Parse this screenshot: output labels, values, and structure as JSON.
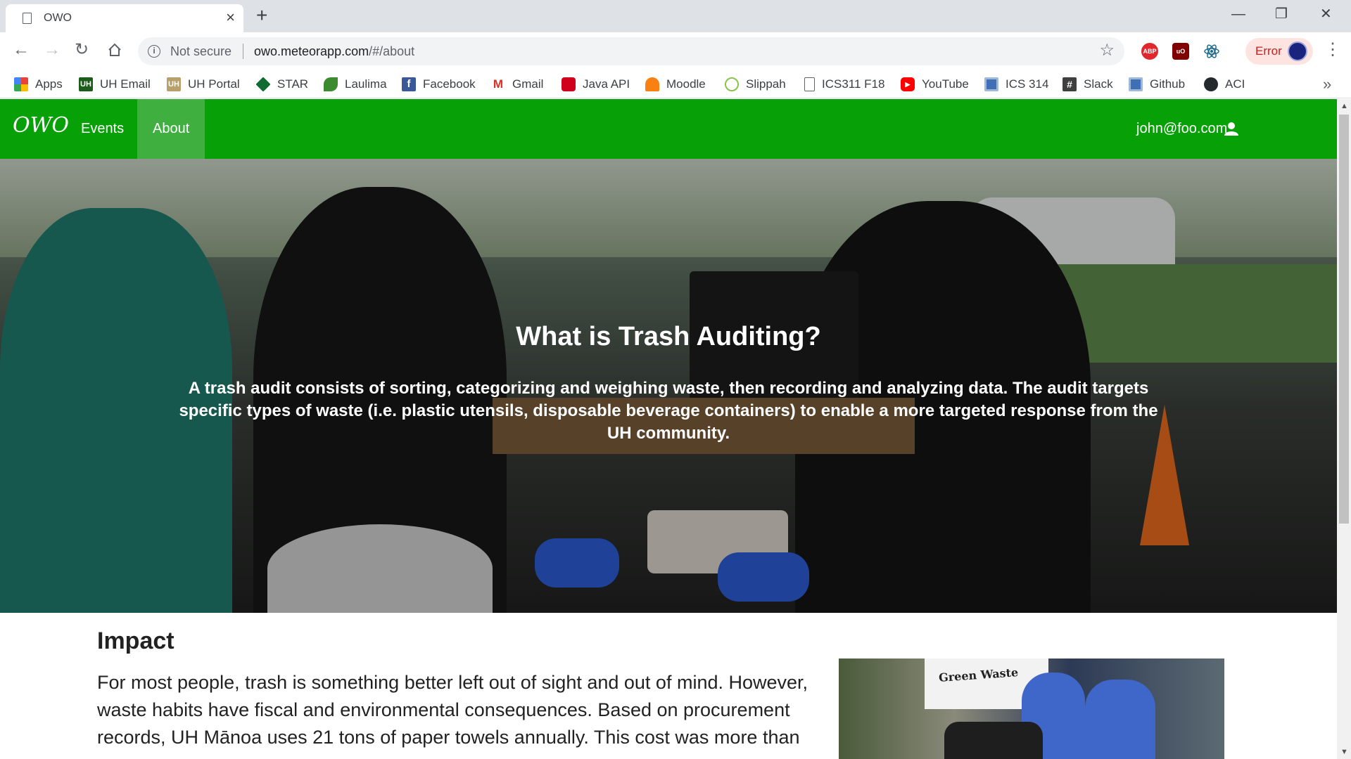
{
  "browser": {
    "tab_title": "OWO",
    "omnibox": {
      "security_label": "Not secure",
      "url_host": "owo.meteorapp.com",
      "url_path": "/#/about"
    },
    "error_label": "Error",
    "bookmarks": [
      {
        "label": "Apps",
        "icon": "apps-grid-icon"
      },
      {
        "label": "UH Email",
        "icon": "uh-icon"
      },
      {
        "label": "UH Portal",
        "icon": "uh-icon"
      },
      {
        "label": "STAR",
        "icon": "star-diamond-icon"
      },
      {
        "label": "Laulima",
        "icon": "leaf-icon"
      },
      {
        "label": "Facebook",
        "icon": "facebook-icon"
      },
      {
        "label": "Gmail",
        "icon": "gmail-icon"
      },
      {
        "label": "Java API",
        "icon": "java-icon"
      },
      {
        "label": "Moodle",
        "icon": "moodle-icon"
      },
      {
        "label": "Slippah",
        "icon": "slippah-icon"
      },
      {
        "label": "ICS311 F18",
        "icon": "document-icon"
      },
      {
        "label": "YouTube",
        "icon": "youtube-icon"
      },
      {
        "label": "ICS 314",
        "icon": "blue-square-icon"
      },
      {
        "label": "Slack",
        "icon": "slack-hash-icon"
      },
      {
        "label": "Github",
        "icon": "blue-square-icon"
      },
      {
        "label": "ACI",
        "icon": "github-icon"
      }
    ],
    "extensions": [
      {
        "label": "ABP",
        "icon": "adblock-icon",
        "color": "#e0272e"
      },
      {
        "label": "uO",
        "icon": "ublock-icon",
        "color": "#800000"
      },
      {
        "label": "",
        "icon": "react-devtools-icon",
        "color": "#1b6b8f"
      }
    ]
  },
  "site": {
    "logo_text": "OWO",
    "nav": [
      {
        "label": "Events",
        "active": false
      },
      {
        "label": "About",
        "active": true
      }
    ],
    "user_email": "john@foo.com",
    "brand_color": "#07a007"
  },
  "hero": {
    "title": "What is Trash Auditing?",
    "body": "A trash audit consists of sorting, categorizing and weighing waste, then recording and analyzing data. The audit targets specific types of waste (i.e. plastic utensils, disposable beverage containers) to enable a more targeted response from the UH community."
  },
  "impact": {
    "title": "Impact",
    "body": "For most people, trash is something better left out of sight and out of mind. However, waste habits have fiscal and environmental consequences. Based on procurement records, UH Mānoa uses 21 tons of paper towels annually. This cost was more than",
    "image_sign": "Green Waste"
  }
}
